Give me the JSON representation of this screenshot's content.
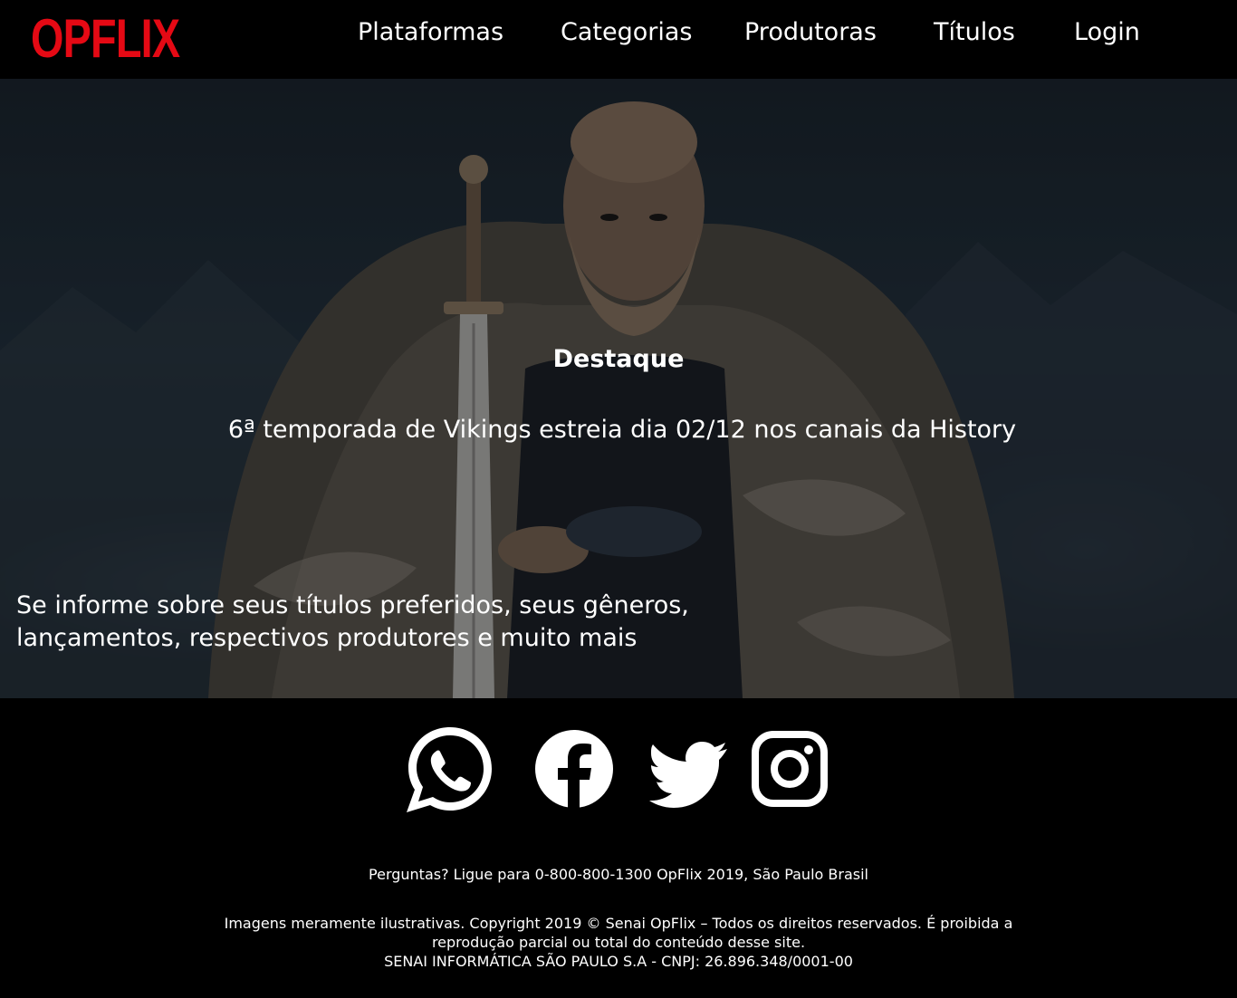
{
  "header": {
    "logo": "OPFLIX",
    "nav": [
      "Plataformas",
      "Categorias",
      "Produtoras",
      "Títulos",
      "Login"
    ]
  },
  "hero": {
    "section_title": "Destaque",
    "headline": "6ª temporada de Vikings estreia dia 02/12 nos canais da History",
    "tagline": "Se informe sobre seus títulos preferidos, seus gêneros, lançamentos, respectivos produtores e muito mais"
  },
  "footer": {
    "social_icons": [
      "whatsapp-icon",
      "facebook-icon",
      "twitter-icon",
      "instagram-icon"
    ],
    "contact": "Perguntas? Ligue para 0-800-800-1300 OpFlix 2019, São Paulo Brasil",
    "copyright_line1": "Imagens meramente ilustrativas. Copyright 2019 © Senai OpFlix – Todos os direitos reservados. É proibida a reprodução parcial ou total do conteúdo desse site.",
    "copyright_line2": "SENAI INFORMÁTICA SÃO PAULO S.A - CNPJ: 26.896.348/0001-00"
  },
  "colors": {
    "brand": "#e50914",
    "background": "#000000",
    "text": "#ffffff"
  }
}
